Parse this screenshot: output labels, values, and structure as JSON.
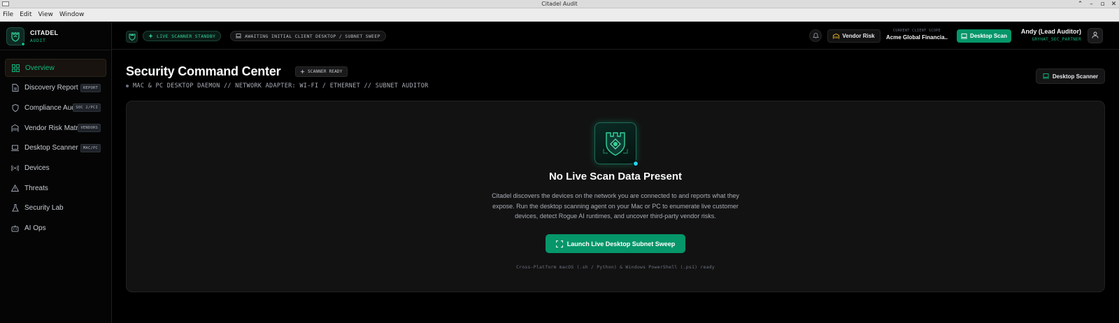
{
  "window": {
    "title": "Citadel Audit",
    "controls": [
      "⌃",
      "–",
      "▫",
      "✕"
    ]
  },
  "menubar": [
    "File",
    "Edit",
    "View",
    "Window"
  ],
  "brand": {
    "name": "CITADEL",
    "sub": "AUDIT"
  },
  "sidebar": {
    "items": [
      {
        "label": "Overview",
        "icon": "grid-icon",
        "active": true
      },
      {
        "label": "Discovery Report",
        "icon": "document-icon",
        "tag": "REPORT"
      },
      {
        "label": "Compliance Audit",
        "icon": "shield-icon",
        "tag": "SOC 2/PCI"
      },
      {
        "label": "Vendor Risk Matrix",
        "icon": "building-icon",
        "tag": "VENDORS"
      },
      {
        "label": "Desktop Scanner",
        "icon": "laptop-icon",
        "tag": "MAC/PC"
      },
      {
        "label": "Devices",
        "icon": "radio-icon"
      },
      {
        "label": "Threats",
        "icon": "warning-icon"
      },
      {
        "label": "Security Lab",
        "icon": "flask-icon"
      },
      {
        "label": "AI Ops",
        "icon": "robot-icon"
      }
    ]
  },
  "header": {
    "live_pill": "LIVE SCANNER STANDBY",
    "await_pill": "AWAITING INITIAL CLIENT DESKTOP / SUBNET SWEEP",
    "vendor_risk": "Vendor Risk",
    "scope_label": "CURRENT CLIENT SCOPE",
    "scope_value": "Acme Global Financia...",
    "desktop_scan": "Desktop Scan",
    "user_name": "Andy (Lead Auditor)",
    "user_handle": "GRYHAT_SEC_PARTNER"
  },
  "main": {
    "title": "Security Command Center",
    "badge": "SCANNER READY",
    "subtitle": "MAC & PC DESKTOP DAEMON // NETWORK ADAPTER: WI-FI / ETHERNET // SUBNET AUDITOR",
    "desktop_scanner_btn": "Desktop Scanner",
    "empty_title": "No Live Scan Data Present",
    "empty_desc": "Citadel discovers the devices on the network you are connected to and reports what they expose. Run the desktop scanning agent on your Mac or PC to enumerate live customer devices, detect Rogue AI runtimes, and uncover third-party vendor risks.",
    "launch_btn": "Launch Live Desktop Subnet Sweep",
    "foot_note": "Cross-Platform macOS (.sh / Python) & Windows PowerShell (.ps1) ready"
  },
  "colors": {
    "accent": "#10b981",
    "accent_button": "#059669",
    "background": "#000000",
    "card": "#121212"
  }
}
